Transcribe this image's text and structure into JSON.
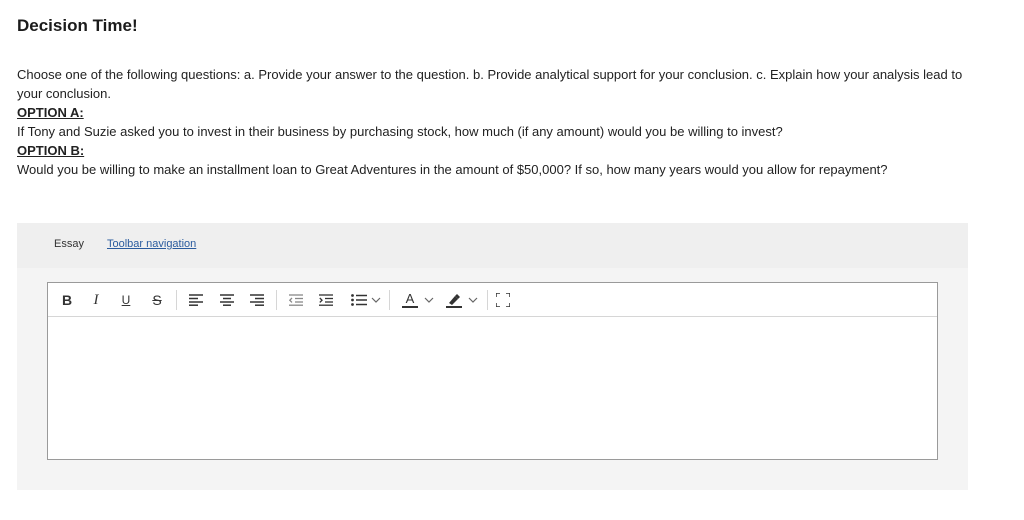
{
  "title": "Decision Time!",
  "question": {
    "intro": "Choose one of the following questions: a. Provide your answer to the question. b. Provide analytical support for your conclusion. c. Explain how your analysis lead to your conclusion.",
    "option_a_label": "OPTION A:",
    "option_a_text": "If Tony and Suzie asked you to invest in their business by purchasing stock, how much (if any amount) would you be willing to invest?",
    "option_b_label": "OPTION B:",
    "option_b_text": "Would you be willing to make an installment loan to Great Adventures in the amount of $50,000? If so, how many years would you allow for repayment?"
  },
  "panel": {
    "essay_label": "Essay",
    "toolbar_link": "Toolbar navigation"
  },
  "toolbar": {
    "bold": "B",
    "italic": "I",
    "underline": "U",
    "strike": "S",
    "font_color": "A"
  },
  "editor": {
    "content": ""
  },
  "colors": {
    "link": "#2a5b9e",
    "panel": "#f4f4f4",
    "highlight": "#4a6dd1"
  },
  "icons": [
    "bold-icon",
    "italic-icon",
    "underline-icon",
    "strikethrough-icon",
    "align-left-icon",
    "align-center-icon",
    "align-right-icon",
    "outdent-icon",
    "indent-icon",
    "bullet-list-icon",
    "font-color-icon",
    "highlight-icon",
    "fullscreen-icon",
    "chevron-down-icon"
  ]
}
